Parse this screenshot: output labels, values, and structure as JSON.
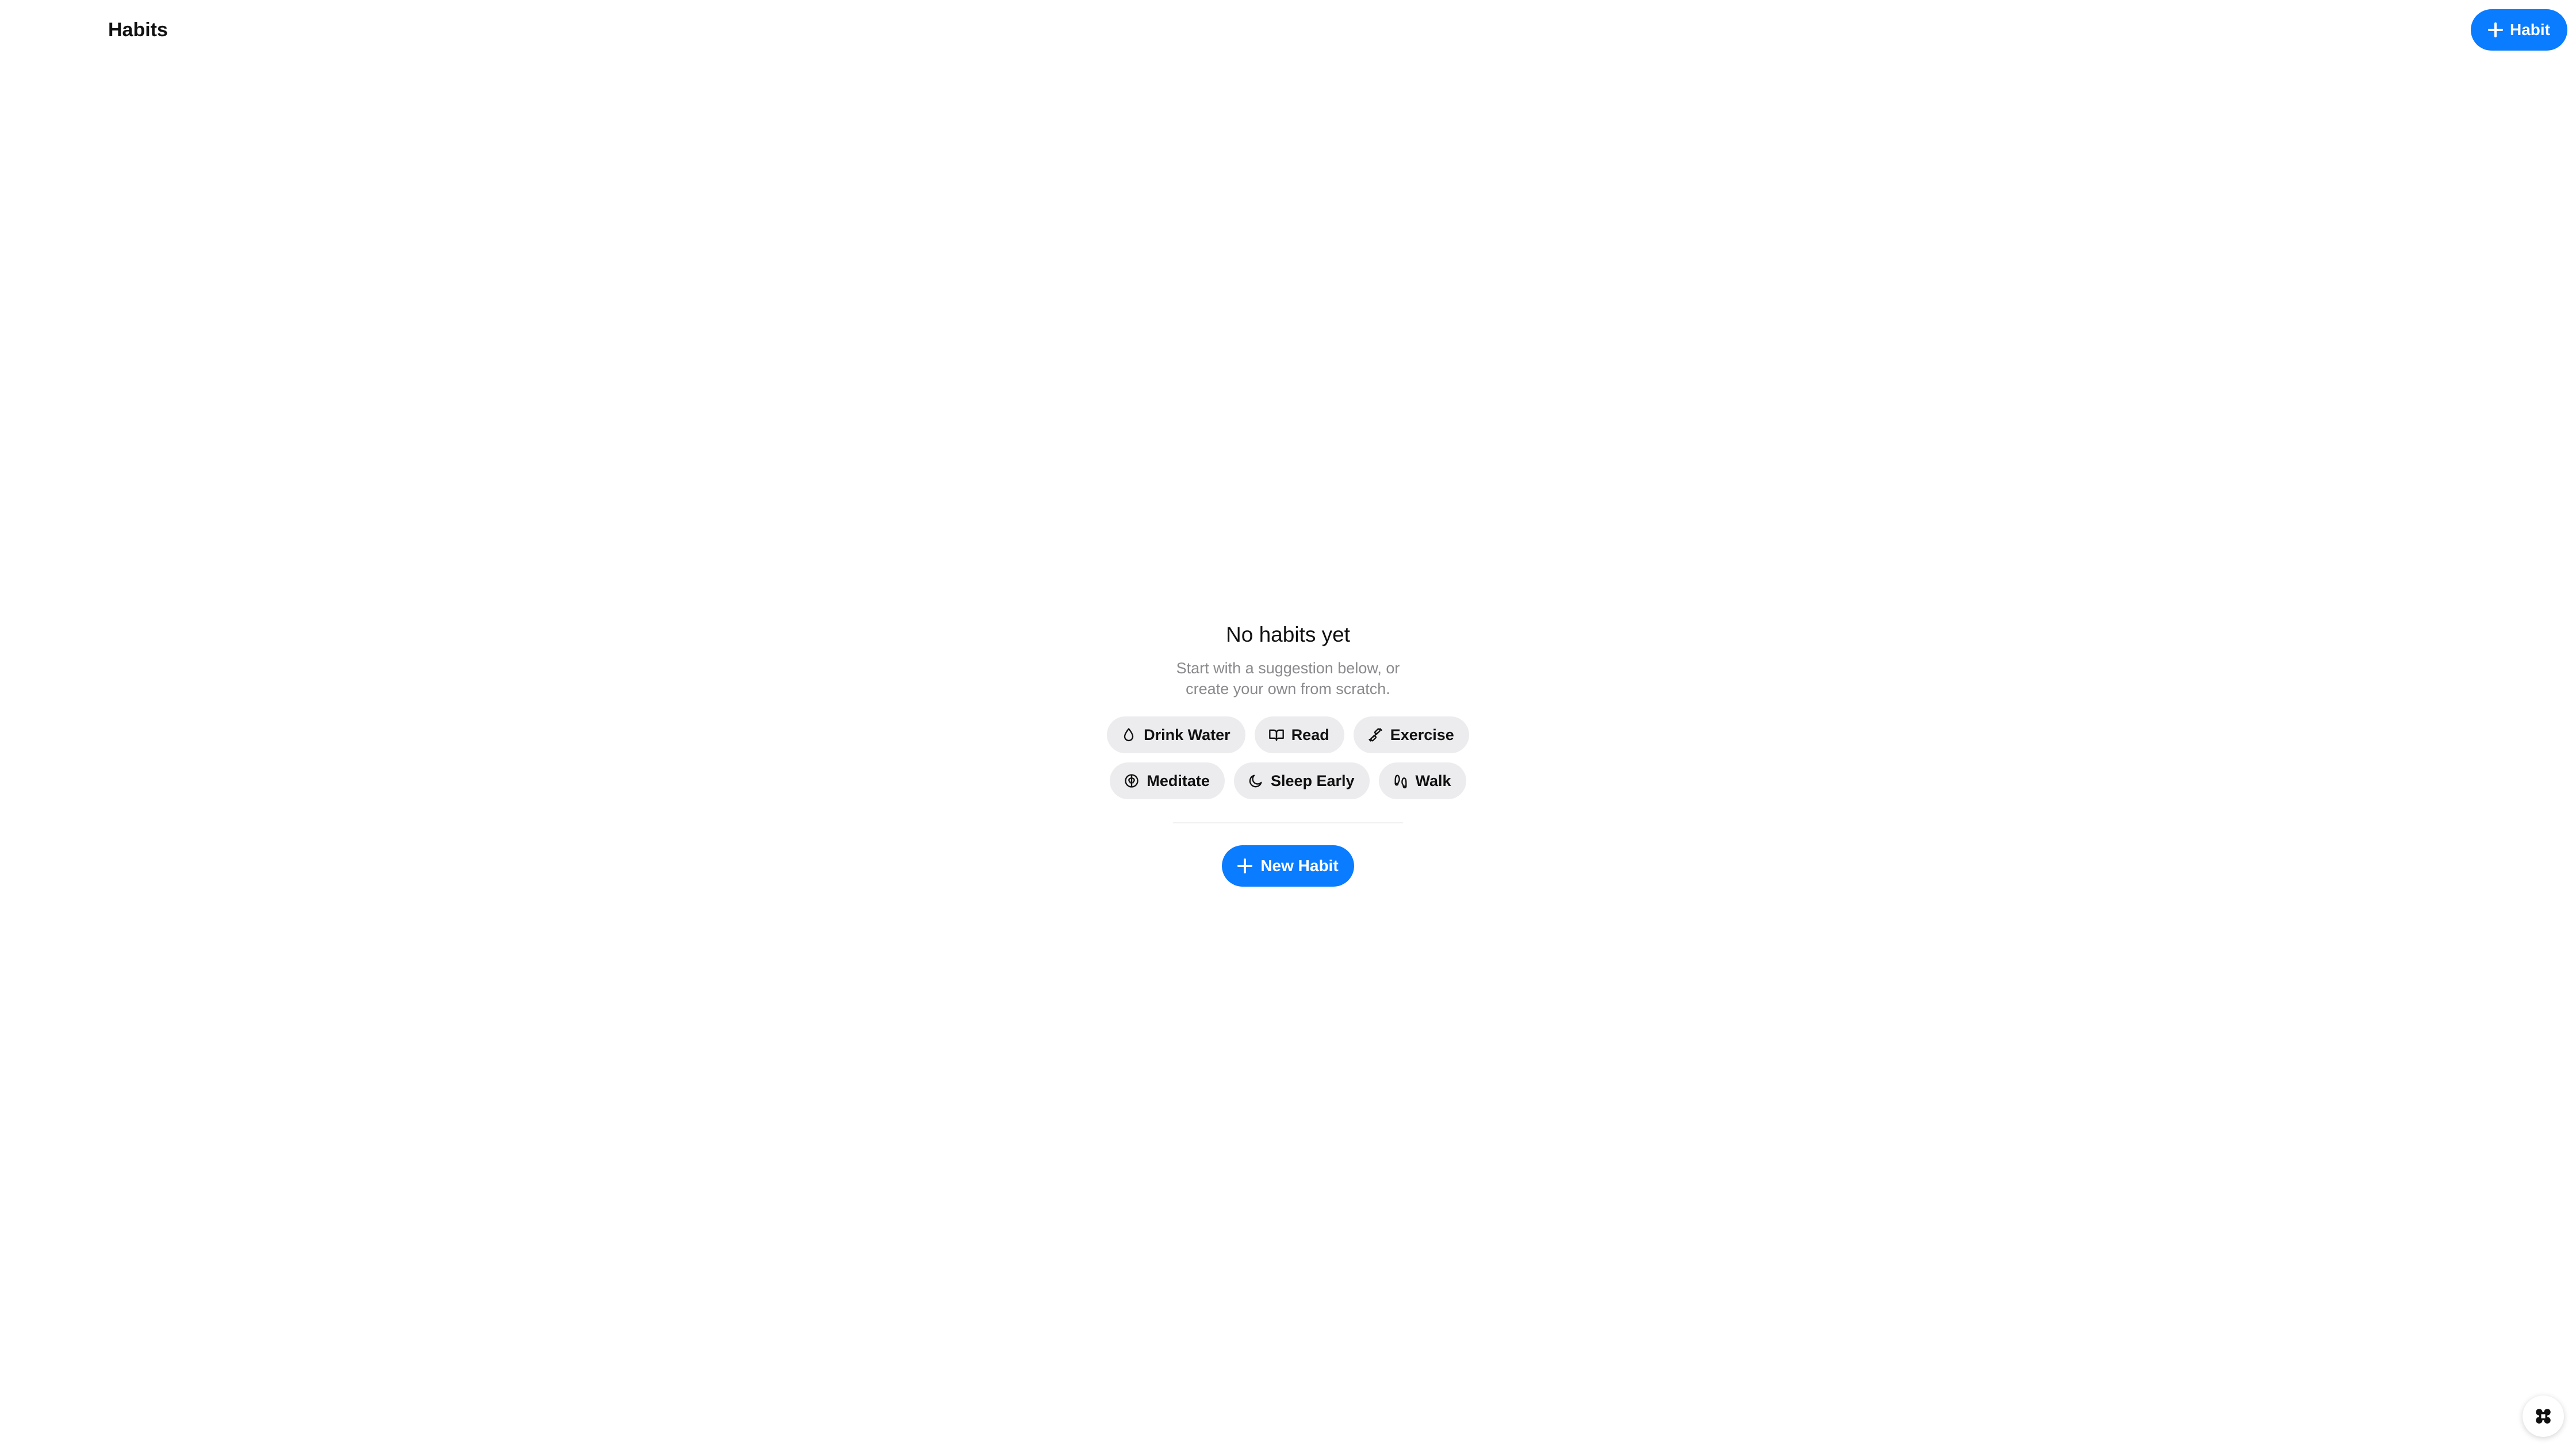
{
  "header": {
    "title": "Habits",
    "add_button_label": "Habit",
    "add_button_icon": "plus-icon"
  },
  "empty_state": {
    "title": "No habits yet",
    "subtitle": "Start with a suggestion below, or create your own from scratch.",
    "suggestions": [
      {
        "label": "Drink Water",
        "icon": "droplet-icon"
      },
      {
        "label": "Read",
        "icon": "book-icon"
      },
      {
        "label": "Exercise",
        "icon": "dumbbell-icon"
      },
      {
        "label": "Meditate",
        "icon": "brain-icon"
      },
      {
        "label": "Sleep Early",
        "icon": "moon-icon"
      },
      {
        "label": "Walk",
        "icon": "footprints-icon"
      }
    ],
    "new_habit_label": "New Habit",
    "new_habit_icon": "plus-icon"
  },
  "floating_button": {
    "icon": "command-icon"
  },
  "colors": {
    "accent": "#0a7cff",
    "chip_bg": "#ececee",
    "muted_text": "#8a8a8e"
  }
}
